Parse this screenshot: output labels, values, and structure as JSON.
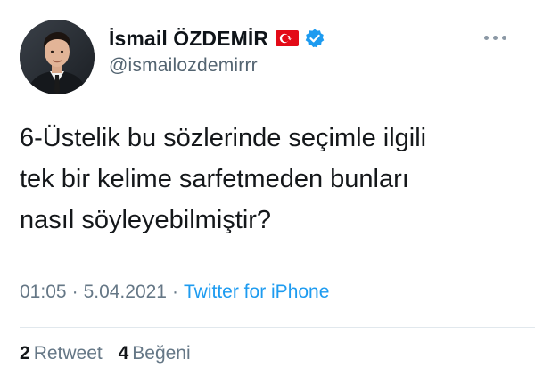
{
  "user": {
    "display_name": "İsmail ÖZDEMİR",
    "handle": "@ismailozdemirrr",
    "flag_icon": "turkey-flag-icon",
    "verified_icon": "verified-badge-icon"
  },
  "tweet": {
    "lines": [
      "6-Üstelik bu sözlerinde seçimle ilgili",
      "tek bir kelime sarfetmeden bunları",
      "nasıl söyleyebilmiştir?"
    ]
  },
  "meta": {
    "time": "01:05",
    "separator": "·",
    "date": "5.04.2021",
    "source": "Twitter for iPhone"
  },
  "stats": {
    "retweet_count": "2",
    "retweet_label": "Retweet",
    "like_count": "4",
    "like_label": "Beğeni"
  },
  "colors": {
    "accent": "#1d9bf0",
    "muted": "#657786",
    "text": "#14171a",
    "flag_red": "#e30a17"
  }
}
